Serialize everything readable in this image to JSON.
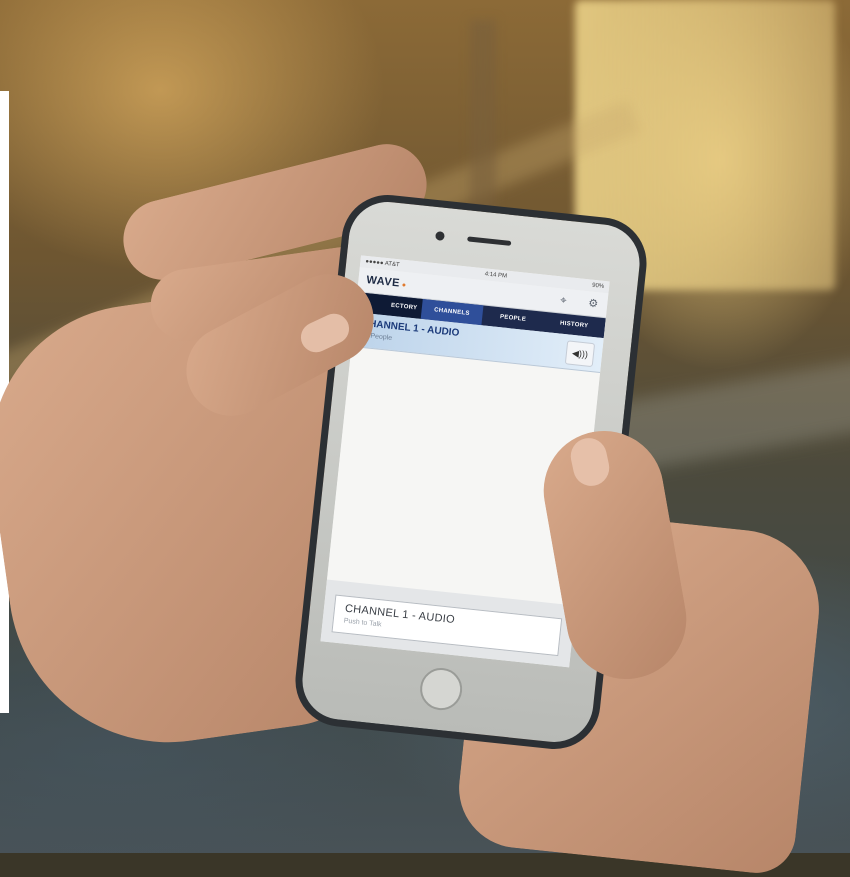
{
  "status_bar": {
    "carrier": "●●●●● AT&T",
    "time": "4:14 PM",
    "battery": "90%"
  },
  "app": {
    "name": "WAVE",
    "mark": "●"
  },
  "icons": {
    "location": "crosshair-icon",
    "settings": "gear-icon",
    "speaker": "speaker-icon"
  },
  "tabs": [
    {
      "label": "ECTORY"
    },
    {
      "label": "CHANNELS"
    },
    {
      "label": "PEOPLE"
    },
    {
      "label": "HISTORY"
    }
  ],
  "channel": {
    "name": "CHANNEL 1 - AUDIO",
    "subtitle": "10 People"
  },
  "push_to_talk": {
    "channel": "CHANNEL 1 - AUDIO",
    "hint": "Push to Talk"
  }
}
